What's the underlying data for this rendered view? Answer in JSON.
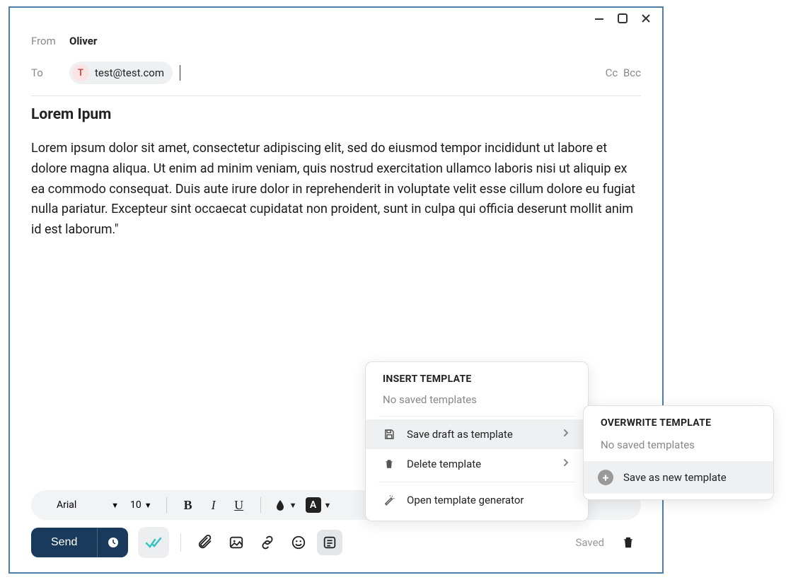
{
  "from": {
    "label": "From",
    "name": "Oliver"
  },
  "to": {
    "label": "To",
    "avatarLetter": "T",
    "email": "test@test.com"
  },
  "cc": "Cc",
  "bcc": "Bcc",
  "subject": "Lorem Ipum",
  "bodyText": "Lorem ipsum dolor sit amet, consectetur adipiscing elit, sed do eiusmod tempor incididunt ut labore et dolore magna aliqua. Ut enim ad minim veniam, quis nostrud exercitation ullamco laboris nisi ut aliquip ex ea commodo consequat. Duis aute irure dolor in reprehenderit in voluptate velit esse cillum dolore eu fugiat nulla pariatur. Excepteur sint occaecat cupidatat non proident, sunt in culpa qui officia deserunt mollit anim id est laborum.\"",
  "toolbar": {
    "font": "Arial",
    "size": "10",
    "fontColorLetter": "A"
  },
  "send": {
    "label": "Send"
  },
  "savedLabel": "Saved",
  "templateMenu": {
    "title": "Insert template",
    "empty": "No saved templates",
    "saveDraft": "Save draft as template",
    "deleteTemplate": "Delete template",
    "openGenerator": "Open template generator"
  },
  "submenu": {
    "title": "Overwrite template",
    "empty": "No saved templates",
    "saveNew": "Save as new template"
  }
}
